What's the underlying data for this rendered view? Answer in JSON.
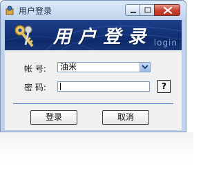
{
  "window": {
    "title": "用户登录",
    "banner_title": "用户登录",
    "banner_sub": "login"
  },
  "form": {
    "account_label": "帐 号:",
    "account_value": "油米",
    "password_label": "密 码:",
    "help_label": "?"
  },
  "buttons": {
    "login": "登录",
    "cancel": "取消"
  },
  "colors": {
    "banner": "#0e2a6b",
    "title_bar": "#c3d6ee",
    "close_button": "#c7412f",
    "separator": "#4a86c8"
  },
  "icons": [
    "app-icon",
    "minimize-icon",
    "maximize-icon",
    "close-icon",
    "keys-icon",
    "dropdown-arrow-icon"
  ]
}
